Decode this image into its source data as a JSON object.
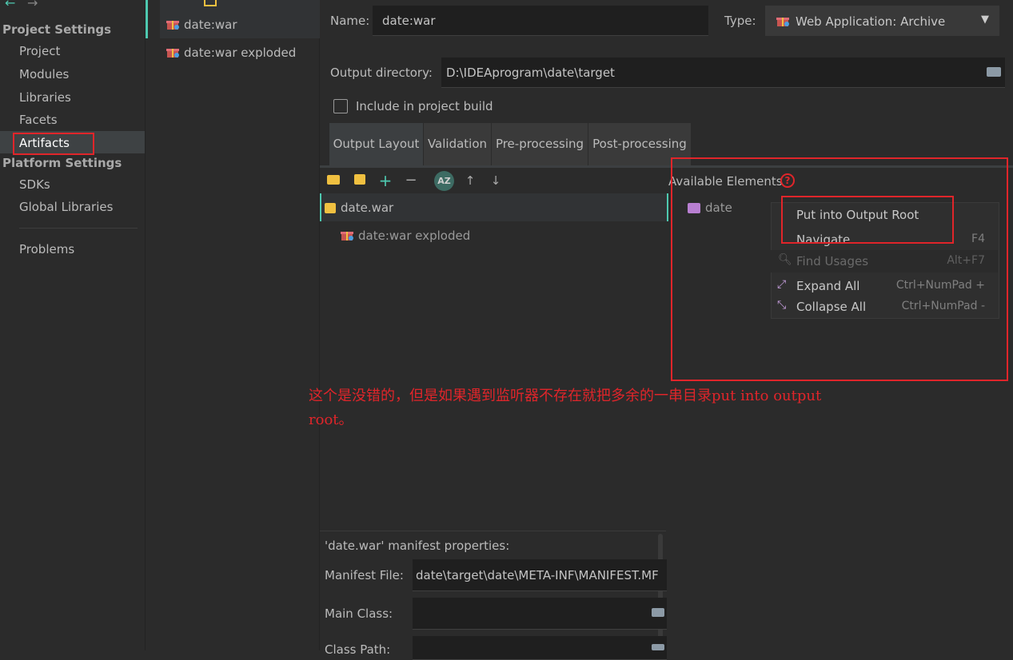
{
  "sidebar": {
    "project_settings_header": "Project Settings",
    "items": [
      "Project",
      "Modules",
      "Libraries",
      "Facets",
      "Artifacts"
    ],
    "platform_settings_header": "Platform Settings",
    "platform_items": [
      "SDKs",
      "Global Libraries"
    ],
    "problems": "Problems"
  },
  "artifacts": [
    "date:war",
    "date:war exploded"
  ],
  "form": {
    "name_label": "Name:",
    "name_value": "date:war",
    "type_label": "Type:",
    "type_value": "Web Application: Archive",
    "output_dir_label": "Output directory:",
    "output_dir_value": "D:\\IDEAprogram\\date\\target",
    "include_label": "Include in project build"
  },
  "tabs": [
    "Output Layout",
    "Validation",
    "Pre-processing",
    "Post-processing"
  ],
  "output_tree": {
    "root": "date.war",
    "child": "date:war exploded"
  },
  "available": {
    "label": "Available Elements",
    "item": "date"
  },
  "context_menu": {
    "items": [
      {
        "label": "Put into Output Root",
        "shortcut": ""
      },
      {
        "label": "Navigate",
        "shortcut": "F4"
      },
      {
        "label": "Find Usages",
        "shortcut": "Alt+F7"
      },
      {
        "label": "Expand All",
        "shortcut": "Ctrl+NumPad +"
      },
      {
        "label": "Collapse All",
        "shortcut": "Ctrl+NumPad -"
      }
    ]
  },
  "annotation": {
    "line1": "这个是没错的，但是如果遇到监听器不存在就把多余的一串目录put into output",
    "line2": "root。"
  },
  "manifest": {
    "title": "'date.war' manifest properties:",
    "file_label": "Manifest File:",
    "file_value": "date\\target\\date\\META-INF\\MANIFEST.MF",
    "main_class_label": "Main Class:",
    "class_path_label": "Class Path:"
  },
  "colors": {
    "highlight_red": "#e0252a",
    "accent_teal": "#4ec9b0",
    "folder_yellow": "#f0c040"
  }
}
